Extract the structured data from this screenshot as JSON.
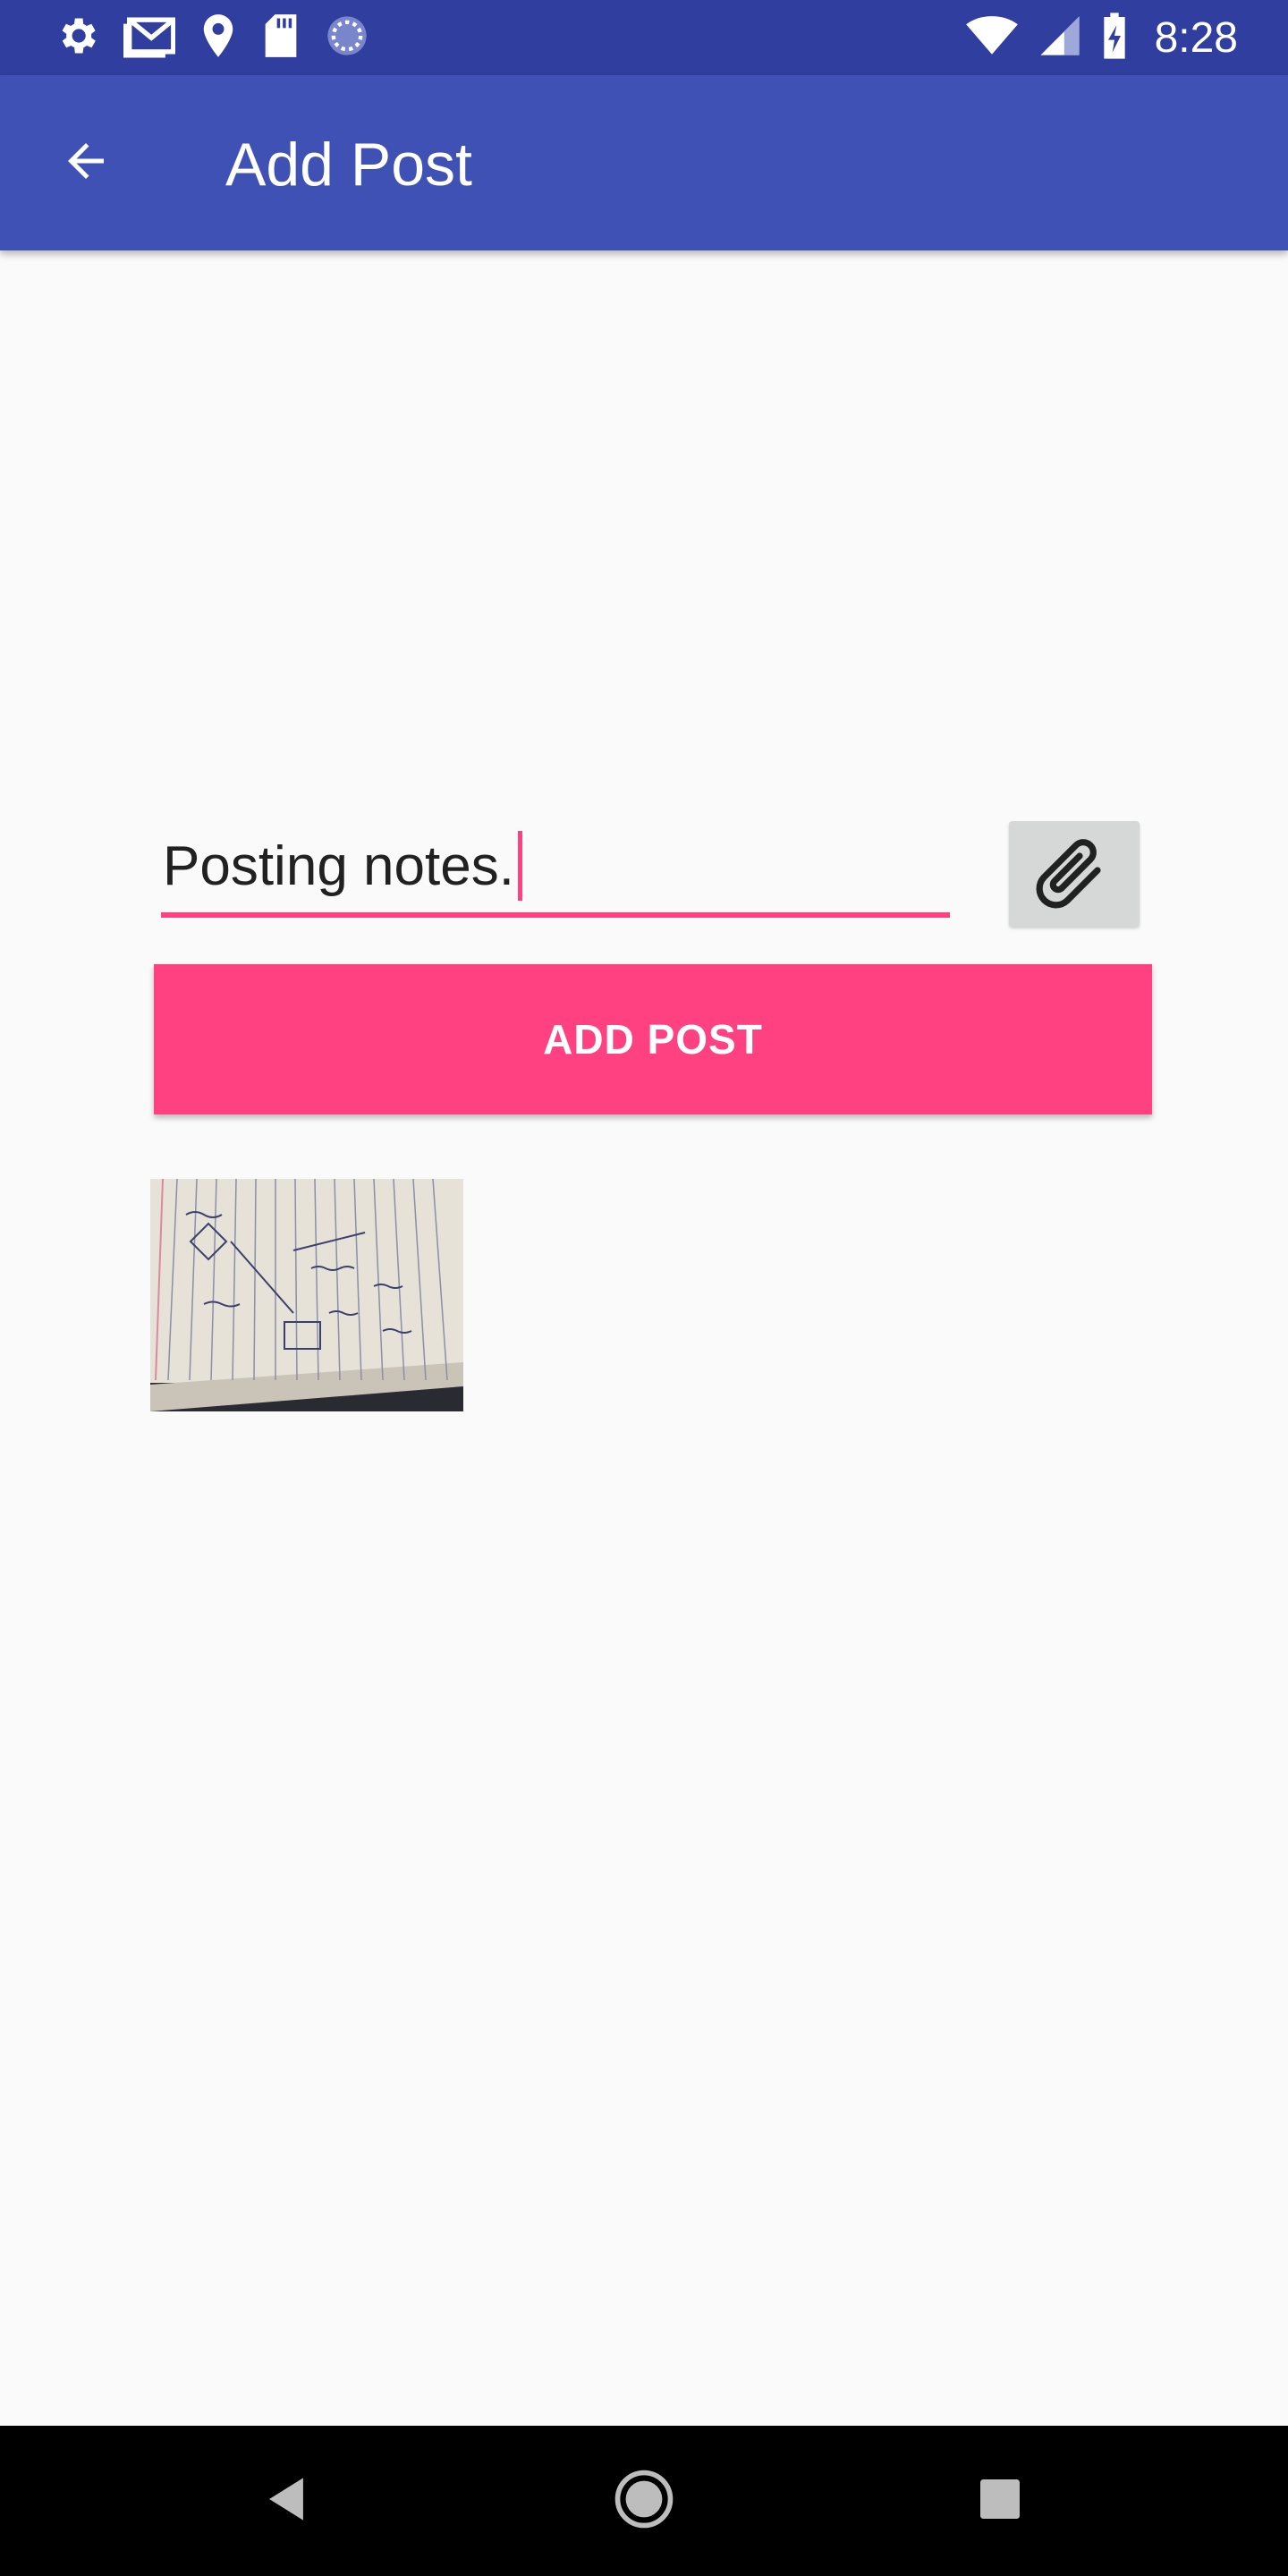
{
  "status_bar": {
    "time": "8:28",
    "left_icons": [
      "settings-icon",
      "gmail-icon",
      "location-icon",
      "sd-card-icon",
      "sync-icon"
    ],
    "right_icons": [
      "wifi-icon",
      "signal-icon",
      "battery-charging-icon"
    ]
  },
  "app_bar": {
    "title": "Add Post",
    "back_icon": "back-arrow-icon"
  },
  "form": {
    "post_text": "Posting notes.",
    "attach_icon": "paperclip-icon",
    "submit_label": "ADD POST"
  },
  "attachment": {
    "thumbnail_icon": "notebook-photo-thumbnail"
  },
  "nav_bar": {
    "icons": [
      "nav-back-icon",
      "nav-home-icon",
      "nav-recents-icon"
    ]
  },
  "colors": {
    "status_bar": "#303f9f",
    "app_bar": "#3f51b5",
    "accent": "#ff4081",
    "background": "#fafafa",
    "attach_button": "#d6d7d7"
  }
}
